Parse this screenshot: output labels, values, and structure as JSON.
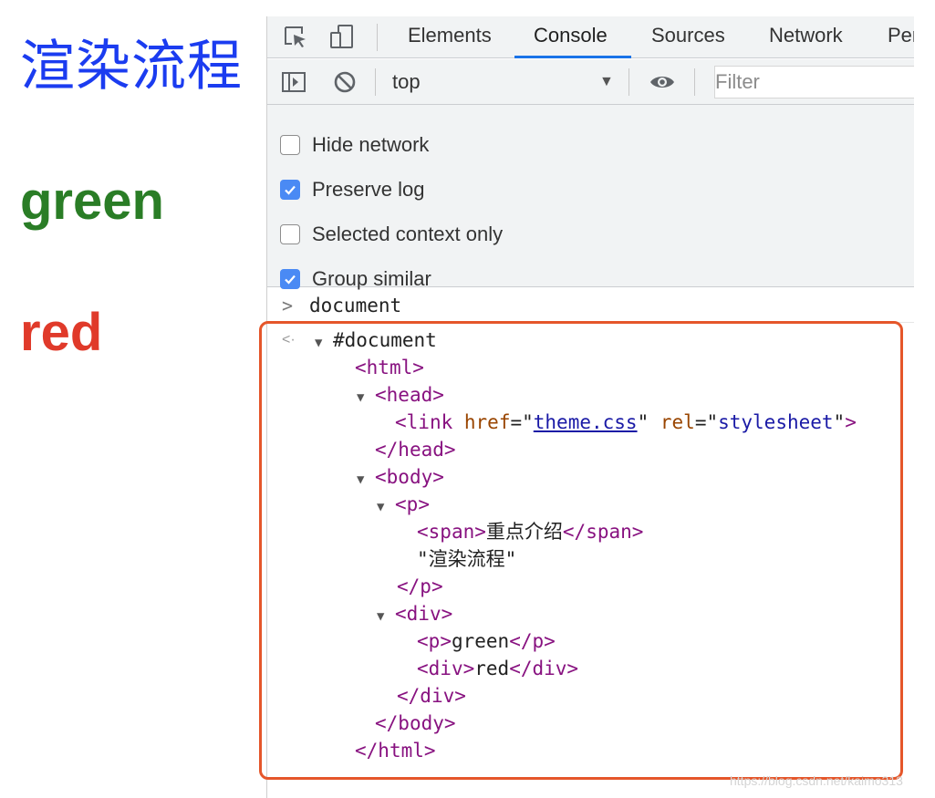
{
  "rendered_page": {
    "title": "渲染流程",
    "green_text": "green",
    "red_text": "red"
  },
  "devtools": {
    "tabs": [
      {
        "label": "Elements",
        "active": false
      },
      {
        "label": "Console",
        "active": true
      },
      {
        "label": "Sources",
        "active": false
      },
      {
        "label": "Network",
        "active": false
      },
      {
        "label": "Per",
        "active": false
      }
    ],
    "toolbar": {
      "context": "top",
      "filter_placeholder": "Filter"
    },
    "settings": [
      {
        "label": "Hide network",
        "checked": false
      },
      {
        "label": "Preserve log",
        "checked": true
      },
      {
        "label": "Selected context only",
        "checked": false
      },
      {
        "label": "Group similar",
        "checked": true
      }
    ],
    "console": {
      "prompt": ">",
      "command": "document",
      "result_arrow": "<·",
      "tree": {
        "document": "#document",
        "html_open": "html",
        "head_open": "head",
        "link_tag": "link",
        "href_attr": "href",
        "href_value": "theme.css",
        "rel_attr": "rel",
        "rel_value": "stylesheet",
        "head_close": "head",
        "body_open": "body",
        "p_open": "p",
        "span_tag": "span",
        "span_text": "重点介绍",
        "p_text": "\"渲染流程\"",
        "p_close": "p",
        "div_open": "div",
        "inner_p_tag": "p",
        "inner_p_text": "green",
        "inner_div_tag": "div",
        "inner_div_text": "red",
        "div_close": "div",
        "body_close": "body",
        "html_close": "html"
      }
    }
  },
  "watermark": "https://blog.csdn.net/kaimo313",
  "colors": {
    "title_blue": "#1b3cf0",
    "green": "#2a7d26",
    "red": "#e03a2a",
    "active_tab_underline": "#1a73e8",
    "checkbox_checked": "#4a8af4",
    "highlight_box": "#e5562a",
    "tag_color": "#881280",
    "attr_color": "#994500",
    "attr_value_color": "#1a1aa6"
  }
}
